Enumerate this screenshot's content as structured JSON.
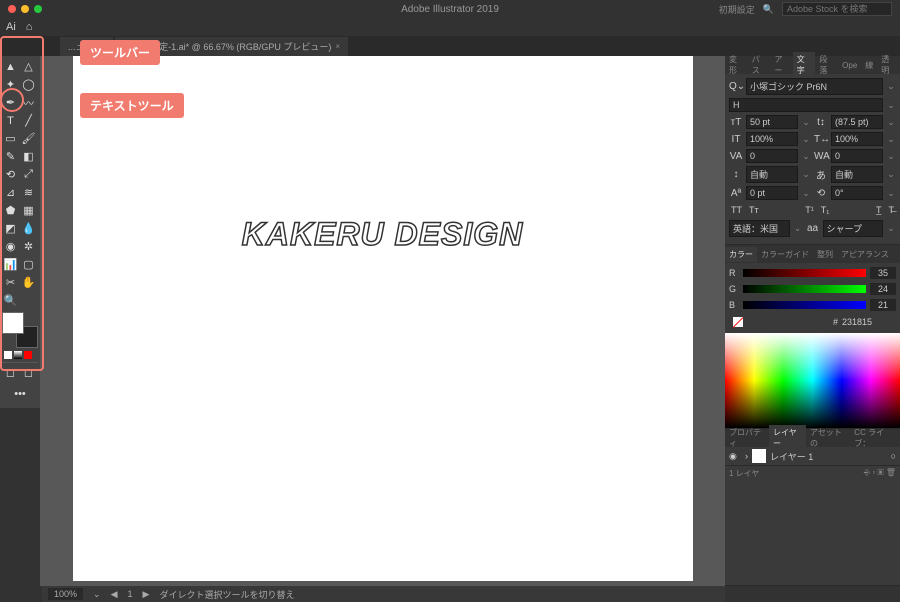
{
  "title": "Adobe Illustrator 2019",
  "header": {
    "preset_label": "初期設定",
    "search_placeholder": "Adobe Stock を検索"
  },
  "tabs": [
    {
      "label": "...ュー)"
    },
    {
      "label": "名称未設定-1.ai* @ 66.67% (RGB/GPU プレビュー)"
    }
  ],
  "callouts": {
    "toolbar": "ツールバー",
    "text_tool": "テキストツール"
  },
  "canvas": {
    "text": "KAKERU DESIGN"
  },
  "character_panel": {
    "tabs": [
      "変形",
      "パス",
      "アー",
      "文字",
      "段落",
      "Ope",
      "線",
      "透明"
    ],
    "font_family": "小塚ゴシック Pr6N",
    "font_style": "H",
    "size": "50 pt",
    "leading": "(87.5 pt)",
    "vscale": "100%",
    "hscale": "100%",
    "tracking_va": "0",
    "tracking_wa": "0",
    "auto_1": "自動",
    "auto_2": "自動",
    "baseline": "0 pt",
    "rotation": "0°",
    "lang": "英語：米国",
    "anti_alias": "シャープ"
  },
  "color_panel": {
    "tabs": [
      "カラー",
      "カラーガイド",
      "整列",
      "アピアランス"
    ],
    "r": 35,
    "g": 24,
    "b": 21,
    "hex": "231815"
  },
  "layers_panel": {
    "tabs": [
      "プロパティ",
      "レイヤー",
      "アセットの",
      "CC ライブ："
    ],
    "layer_name": "レイヤー 1",
    "footer": "1 レイヤ"
  },
  "status": {
    "zoom": "100%",
    "tool_label": "ダイレクト選択ツールを切り替え"
  },
  "icons": {
    "home": "⌂",
    "search": "🔍",
    "select": "▲",
    "direct": "△",
    "wand": "✦",
    "lasso": "◯",
    "pen": "✒",
    "curve": "〰",
    "type": "T",
    "line": "╱",
    "rect": "▭",
    "brush": "🖌",
    "pencil": "✎",
    "eraser": "◧",
    "rotate": "⟲",
    "scale": "⤢",
    "width": "⊿",
    "warp": "≋",
    "shape_b": "⬟",
    "mesh": "▦",
    "grad": "◩",
    "eyedrop": "💧",
    "blend": "◉",
    "symbol": "✲",
    "graph": "📊",
    "artboard": "▢",
    "slice": "✂",
    "hand": "✋",
    "zoom": "🔍",
    "ellipsis": "•••"
  }
}
